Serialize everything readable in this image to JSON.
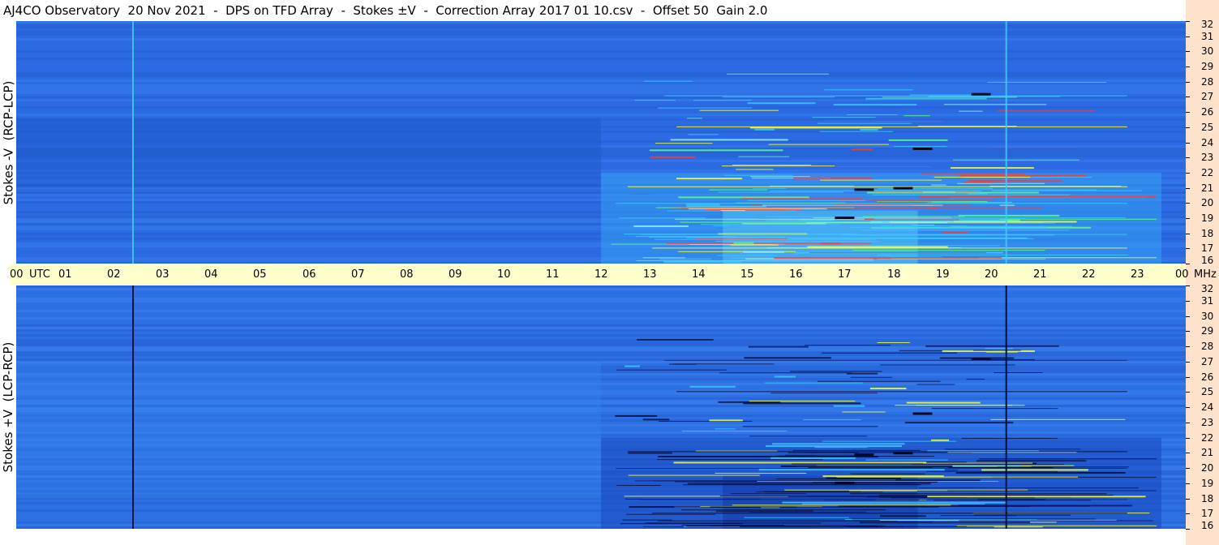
{
  "title": "AJ4CO Observatory  20 Nov 2021  -  DPS on TFD Array  -  Stokes ±V  -  Correction Array 2017 01 10.csv  -  Offset 50  Gain 2.0",
  "colors": {
    "background": "#ffffff",
    "time_bar": "#ffffcc",
    "right_strip": "#ffe2cc",
    "base_blue": "#2a6ae0",
    "deep_blue": "#0a2a9a",
    "cyan": "#3cc8ff",
    "green": "#5dff7a",
    "yellow": "#f4ff3c",
    "red": "#ff3b2b",
    "dark": "#001040"
  },
  "chart_data": [
    {
      "type": "heatmap",
      "panel": "top",
      "ylabel": "Stokes -V  (RCP-LCP)",
      "x_unit": "UTC",
      "x_ticks": [
        "00",
        "01",
        "02",
        "03",
        "04",
        "05",
        "06",
        "07",
        "08",
        "09",
        "10",
        "11",
        "12",
        "13",
        "14",
        "15",
        "16",
        "17",
        "18",
        "19",
        "20",
        "21",
        "22",
        "23",
        "00"
      ],
      "x_range": [
        0,
        24
      ],
      "y_unit": "MHz",
      "y_ticks": [
        "32",
        "31",
        "30",
        "29",
        "28",
        "27",
        "26",
        "25",
        "24",
        "23",
        "22",
        "21",
        "20",
        "19",
        "18",
        "17",
        "16"
      ],
      "y_range": [
        16,
        32
      ],
      "activity_window_utc": [
        12,
        23.5
      ],
      "vertical_markers_utc": [
        2.38,
        20.3
      ],
      "marker_color": "#44c8ff"
    },
    {
      "type": "heatmap",
      "panel": "bottom",
      "ylabel": "Stokes +V  (LCP-RCP)",
      "x_unit": "UTC",
      "x_ticks": [
        "00",
        "01",
        "02",
        "03",
        "04",
        "05",
        "06",
        "07",
        "08",
        "09",
        "10",
        "11",
        "12",
        "13",
        "14",
        "15",
        "16",
        "17",
        "18",
        "19",
        "20",
        "21",
        "22",
        "23",
        "00"
      ],
      "x_range": [
        0,
        24
      ],
      "y_unit": "MHz",
      "y_ticks": [
        "32",
        "31",
        "30",
        "29",
        "28",
        "27",
        "26",
        "25",
        "24",
        "23",
        "22",
        "21",
        "20",
        "19",
        "18",
        "17",
        "16"
      ],
      "y_range": [
        16,
        32
      ],
      "activity_window_utc": [
        12,
        23.5
      ],
      "vertical_markers_utc": [
        2.38,
        20.3
      ],
      "marker_color": "#001040"
    }
  ],
  "axis": {
    "utc_label": "UTC",
    "mhz_label": "MHz"
  }
}
